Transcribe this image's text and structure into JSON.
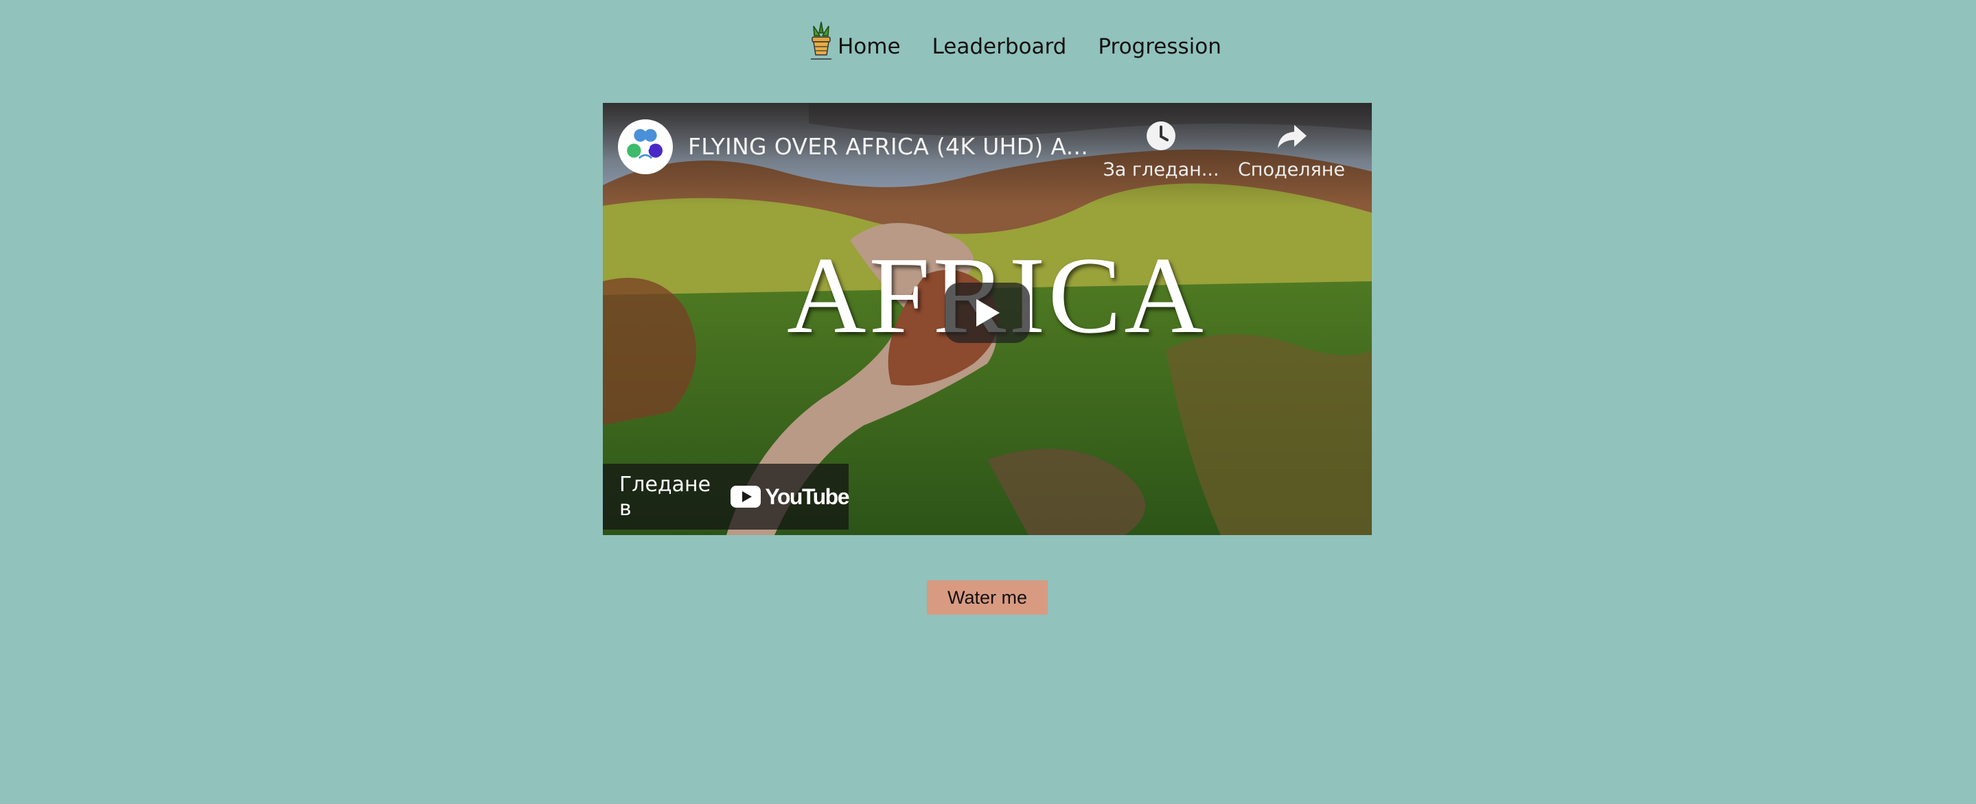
{
  "nav": {
    "logo_icon": "potted-plant-icon",
    "items": [
      {
        "label": "Home"
      },
      {
        "label": "Leaderboard"
      },
      {
        "label": "Progression"
      }
    ]
  },
  "video": {
    "title": "FLYING OVER AFRICA (4K UHD) A...",
    "thumbnail_text": "AFRICA",
    "watch_later_label": "За гледан...",
    "share_label": "Споделяне",
    "watch_on_label": "Гледане в",
    "platform_label": "YouTube",
    "icons": [
      "clock-icon",
      "share-arrow-icon",
      "play-icon",
      "youtube-logo-icon"
    ]
  },
  "actions": {
    "water_label": "Water me"
  },
  "colors": {
    "background": "#91c2bc",
    "button": "#d99a82"
  }
}
